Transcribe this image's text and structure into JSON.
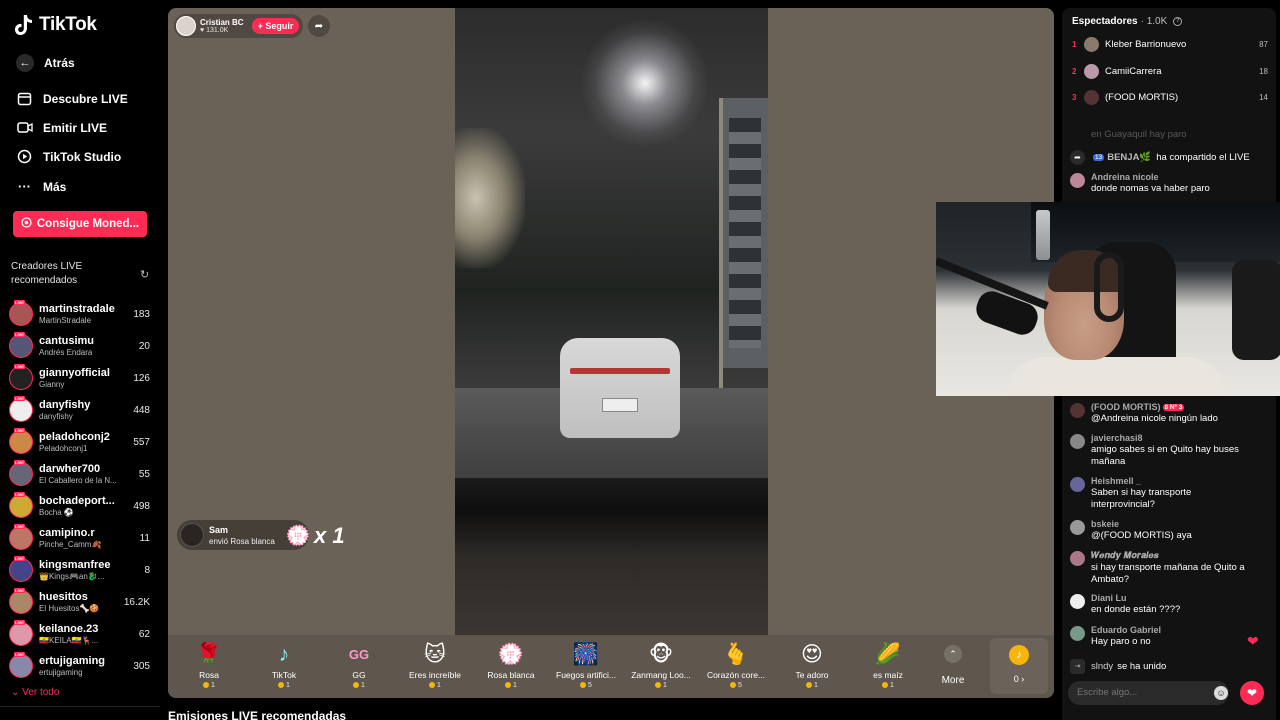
{
  "app": {
    "name": "TikTok"
  },
  "nav": {
    "back": "Atrás",
    "discover": "Descubre LIVE",
    "go_live": "Emitir LIVE",
    "studio": "TikTok Studio",
    "more": "Más",
    "coins_button": "Consigue Moned..."
  },
  "sidebar": {
    "section_title": "Creadores LIVE recomendados",
    "see_all": "Ver todo",
    "creators": [
      {
        "name": "martinstradale",
        "sub": "MartinStradale",
        "count": "183"
      },
      {
        "name": "cantusimu",
        "sub": "Andrés Endara",
        "count": "20"
      },
      {
        "name": "giannyofficial",
        "sub": "Gianny",
        "count": "126"
      },
      {
        "name": "danyfishy",
        "sub": "danyfishy",
        "count": "448"
      },
      {
        "name": "peladohconj2",
        "sub": "Peladohconj1",
        "count": "557"
      },
      {
        "name": "darwher700",
        "sub": "El Caballero de la N...",
        "count": "55"
      },
      {
        "name": "bochadeport...",
        "sub": "Bocha ⚽",
        "count": "498"
      },
      {
        "name": "camipino.r",
        "sub": "Pinche_Camm🍂",
        "count": "11"
      },
      {
        "name": "kingsmanfree",
        "sub": "👑Kings🎮an🐉...",
        "count": "8"
      },
      {
        "name": "huesittos",
        "sub": "El Huesitos🦴🍪",
        "count": "16.2K"
      },
      {
        "name": "keilanoe.23",
        "sub": "🇪🇨KEILA🇪🇨🦌...",
        "count": "62"
      },
      {
        "name": "ertujigaming",
        "sub": "ertujigaming",
        "count": "305"
      }
    ]
  },
  "stage": {
    "host_name": "Cristian BC",
    "host_likes": "♥ 131.0K",
    "follow_label": "+ Seguir",
    "gift_toast": {
      "user": "Sam",
      "desc": "envió Rosa blanca",
      "multiplier": "x 1"
    },
    "gifts": [
      {
        "icon": "🌹",
        "name": "Rosa",
        "price": "1"
      },
      {
        "icon": "♪",
        "name": "TikTok",
        "price": "1"
      },
      {
        "icon": "GG",
        "name": "GG",
        "price": "1"
      },
      {
        "icon": "🐱",
        "name": "Eres increíble",
        "price": "1"
      },
      {
        "icon": "💮",
        "name": "Rosa blanca",
        "price": "1"
      },
      {
        "icon": "🎆",
        "name": "Fuegos artifici...",
        "price": "5"
      },
      {
        "icon": "🐵",
        "name": "Zanmang Loo...",
        "price": "1"
      },
      {
        "icon": "🫰",
        "name": "Corazón core...",
        "price": "5"
      },
      {
        "icon": "😍",
        "name": "Te adoro",
        "price": "1"
      },
      {
        "icon": "🌽",
        "name": "es maíz",
        "price": "1"
      }
    ],
    "more_label": "More",
    "wallet_value": "0 ›"
  },
  "below": {
    "recommended_title": "Emisiones LIVE recomendadas"
  },
  "panel": {
    "viewers_label": "Espectadores",
    "viewers_count": "· 1.0K",
    "top_viewers": [
      {
        "rank": "1",
        "name": "Kleber Barrionuevo",
        "score": "87"
      },
      {
        "rank": "2",
        "name": "CamiiCarrera",
        "score": "18"
      },
      {
        "rank": "3",
        "name": "(FOOD MORTIS)",
        "score": "14"
      }
    ],
    "chat": {
      "faded": "en Guayaquil hay paro",
      "share": {
        "badge": "13",
        "user": "BENJA🌿",
        "text": "ha compartido el LIVE"
      },
      "messages": [
        {
          "user": "Andreina nicole",
          "text": "donde nomas va haber paro"
        },
        {
          "user": "(FOOD MORTIS)",
          "badge": "8 Nº 3",
          "text": "@Andreina nicole ningún lado"
        },
        {
          "user": "javierchasi8",
          "text": "amigo sabes si en Quito hay buses mañana"
        },
        {
          "user": "Heishmell _",
          "text": "Saben si hay transporte interprovincial?"
        },
        {
          "user": "bskeie",
          "text": "@(FOOD MORTIS) aya"
        },
        {
          "user": "𝑾𝒆𝒏𝒅𝒚 𝑴𝒐𝒓𝒂𝒍𝒆𝒔",
          "text": "si hay transporte mañana de Quito a Ambato?"
        },
        {
          "user": "Diani Lu",
          "text": "en donde están ????"
        },
        {
          "user": "Eduardo Gabriel",
          "text": "Hay paro o no"
        }
      ],
      "joined": {
        "user": "slndy",
        "text": "se ha unido"
      }
    },
    "input_placeholder": "Escribe algo..."
  }
}
